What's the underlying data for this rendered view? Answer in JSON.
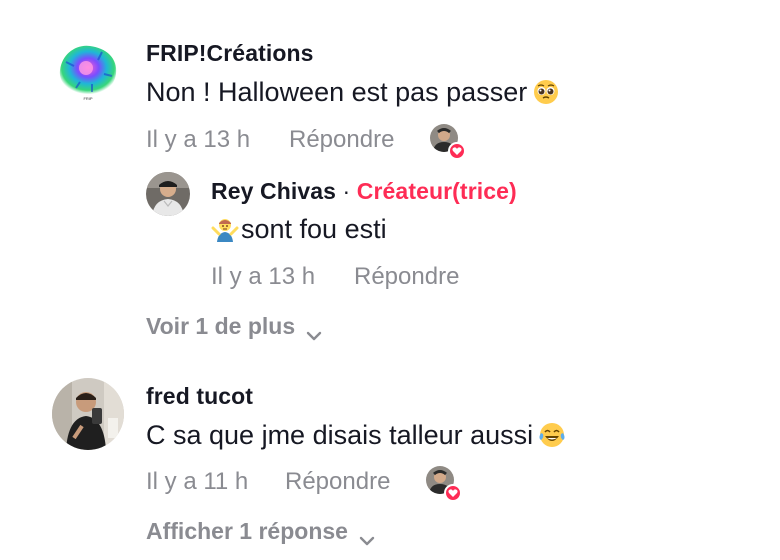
{
  "comments": [
    {
      "username": "FRIP!Créations",
      "text": "Non ! Halloween est pas passer",
      "emoji": "pleading-face-emoji",
      "time": "Il y a 13 h",
      "reply_label": "Répondre",
      "liked_by_creator": true,
      "replies": [
        {
          "username": "Rey Chivas",
          "separator": "·",
          "badge": "Créateur(trice)",
          "text": "sont fou esti",
          "emoji": "person-shrugging-emoji",
          "time": "Il y a 13 h",
          "reply_label": "Répondre"
        }
      ],
      "more_label": "Voir 1 de plus"
    },
    {
      "username": "fred tucot",
      "text": "C sa que jme disais talleur aussi",
      "emoji": "tears-of-joy-emoji",
      "time": "Il y a 11 h",
      "reply_label": "Répondre",
      "liked_by_creator": true,
      "more_label": "Afficher 1 réponse"
    }
  ],
  "colors": {
    "text_primary": "#161823",
    "text_secondary": "#8a8b91",
    "creator_accent": "#fe2c55"
  },
  "icons": [
    "chevron-down-icon",
    "heart-icon"
  ]
}
